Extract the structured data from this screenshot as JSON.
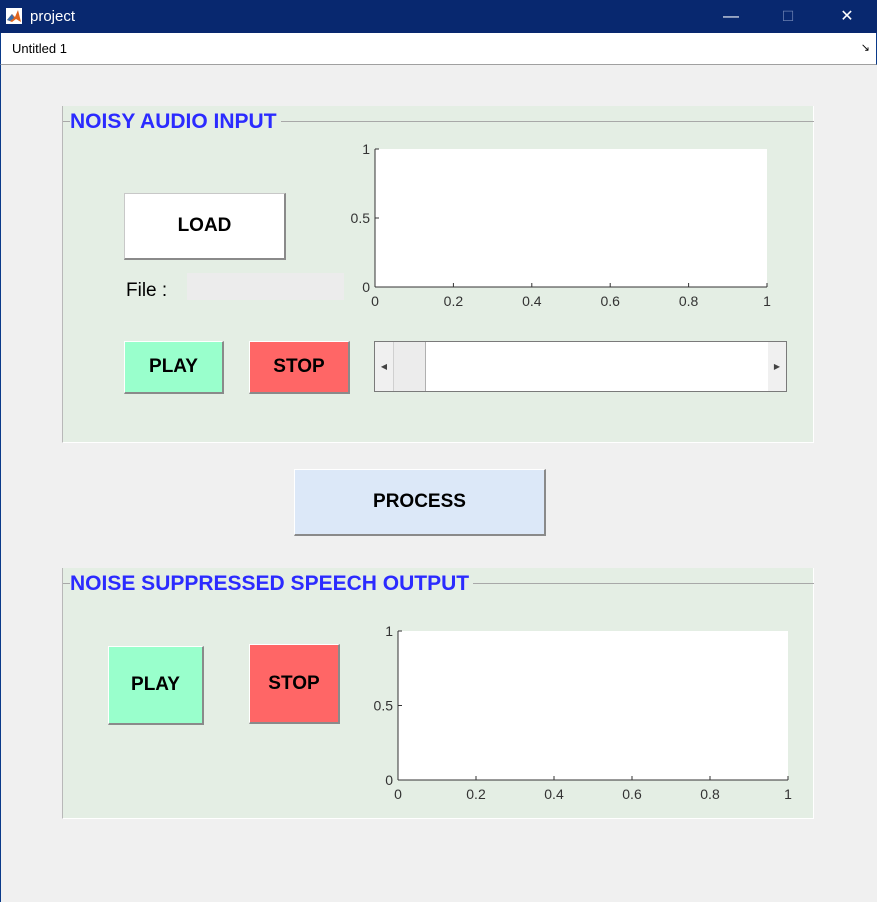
{
  "window": {
    "title": "project",
    "minimize": "—",
    "maximize": "☐",
    "close": "✕"
  },
  "menubar": {
    "tab": "Untitled 1",
    "dock_icon": "↘"
  },
  "input_panel": {
    "title": "NOISY AUDIO INPUT",
    "load_label": "LOAD",
    "file_label": "File :",
    "file_value": "",
    "play_label": "PLAY",
    "stop_label": "STOP",
    "slider_value": 0
  },
  "process_label": "PROCESS",
  "output_panel": {
    "title": "NOISE SUPPRESSED SPEECH OUTPUT",
    "play_label": "PLAY",
    "stop_label": "STOP"
  },
  "chart_data": [
    {
      "type": "line",
      "title": "",
      "xlabel": "",
      "ylabel": "",
      "xlim": [
        0,
        1
      ],
      "ylim": [
        0,
        1
      ],
      "xticks": [
        "0",
        "0.2",
        "0.4",
        "0.6",
        "0.8",
        "1"
      ],
      "yticks": [
        "0",
        "0.5",
        "1"
      ],
      "series": []
    },
    {
      "type": "line",
      "title": "",
      "xlabel": "",
      "ylabel": "",
      "xlim": [
        0,
        1
      ],
      "ylim": [
        0,
        1
      ],
      "xticks": [
        "0",
        "0.2",
        "0.4",
        "0.6",
        "0.8",
        "1"
      ],
      "yticks": [
        "0",
        "0.5",
        "1"
      ],
      "series": []
    }
  ],
  "colors": {
    "titlebar": "#08286f",
    "panel": "#e4eee4",
    "panel_title": "#2b2bff",
    "play": "#99ffcc",
    "stop": "#ff6666",
    "process": "#dce8f8"
  }
}
